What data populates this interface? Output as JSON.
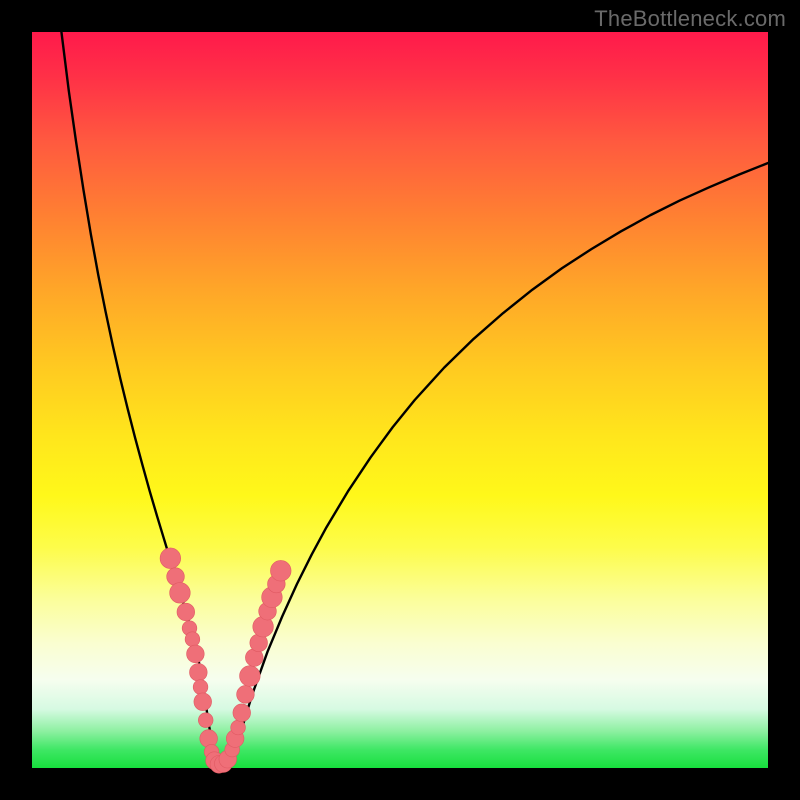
{
  "watermark": "TheBottleneck.com",
  "colors": {
    "frame": "#000000",
    "curve": "#000000",
    "marker_fill": "#ef6f78",
    "marker_stroke": "#e05a63"
  },
  "chart_data": {
    "type": "line",
    "title": "",
    "xlabel": "",
    "ylabel": "",
    "xlim": [
      0,
      100
    ],
    "ylim": [
      0,
      100
    ],
    "grid": false,
    "series": [
      {
        "name": "curve",
        "x": [
          4,
          5,
          6,
          7,
          8,
          9,
          10,
          11,
          12,
          13,
          14,
          15,
          16,
          17,
          18,
          19,
          20,
          21,
          22,
          22.8,
          23.5,
          24,
          24.6,
          25.2,
          26,
          27,
          28,
          29,
          30,
          32,
          34,
          36,
          38,
          40,
          43,
          46,
          49,
          52,
          56,
          60,
          64,
          68,
          72,
          76,
          80,
          84,
          88,
          92,
          96,
          100
        ],
        "values": [
          100,
          92,
          85,
          78.5,
          72.5,
          67,
          62,
          57.3,
          52.9,
          48.8,
          44.9,
          41.2,
          37.6,
          34.2,
          30.9,
          27.6,
          24.3,
          21,
          17.5,
          13.8,
          9.5,
          6,
          3,
          1,
          0.2,
          0.9,
          3.5,
          7,
          10.2,
          15.8,
          20.6,
          25,
          29,
          32.7,
          37.7,
          42.2,
          46.3,
          50,
          54.4,
          58.3,
          61.8,
          65,
          67.9,
          70.5,
          72.9,
          75.1,
          77.1,
          78.9,
          80.6,
          82.2
        ]
      }
    ],
    "markers": [
      {
        "x": 18.8,
        "y": 28.5,
        "r": 1.4
      },
      {
        "x": 19.5,
        "y": 26.0,
        "r": 1.2
      },
      {
        "x": 20.1,
        "y": 23.8,
        "r": 1.4
      },
      {
        "x": 20.9,
        "y": 21.2,
        "r": 1.2
      },
      {
        "x": 21.4,
        "y": 19.0,
        "r": 1.0
      },
      {
        "x": 21.8,
        "y": 17.5,
        "r": 1.0
      },
      {
        "x": 22.2,
        "y": 15.5,
        "r": 1.2
      },
      {
        "x": 22.6,
        "y": 13.0,
        "r": 1.2
      },
      {
        "x": 22.9,
        "y": 11.0,
        "r": 1.0
      },
      {
        "x": 23.2,
        "y": 9.0,
        "r": 1.2
      },
      {
        "x": 23.6,
        "y": 6.5,
        "r": 1.0
      },
      {
        "x": 24.0,
        "y": 4.0,
        "r": 1.2
      },
      {
        "x": 24.4,
        "y": 2.2,
        "r": 1.0
      },
      {
        "x": 24.8,
        "y": 1.0,
        "r": 1.2
      },
      {
        "x": 25.4,
        "y": 0.5,
        "r": 1.2
      },
      {
        "x": 26.0,
        "y": 0.6,
        "r": 1.2
      },
      {
        "x": 26.6,
        "y": 1.2,
        "r": 1.2
      },
      {
        "x": 27.2,
        "y": 2.5,
        "r": 1.0
      },
      {
        "x": 27.6,
        "y": 4.0,
        "r": 1.2
      },
      {
        "x": 28.0,
        "y": 5.5,
        "r": 1.0
      },
      {
        "x": 28.5,
        "y": 7.5,
        "r": 1.2
      },
      {
        "x": 29.0,
        "y": 10.0,
        "r": 1.2
      },
      {
        "x": 29.6,
        "y": 12.5,
        "r": 1.4
      },
      {
        "x": 30.2,
        "y": 15.0,
        "r": 1.2
      },
      {
        "x": 30.8,
        "y": 17.0,
        "r": 1.2
      },
      {
        "x": 31.4,
        "y": 19.2,
        "r": 1.4
      },
      {
        "x": 32.0,
        "y": 21.3,
        "r": 1.2
      },
      {
        "x": 32.6,
        "y": 23.2,
        "r": 1.4
      },
      {
        "x": 33.2,
        "y": 25.0,
        "r": 1.2
      },
      {
        "x": 33.8,
        "y": 26.8,
        "r": 1.4
      }
    ]
  }
}
